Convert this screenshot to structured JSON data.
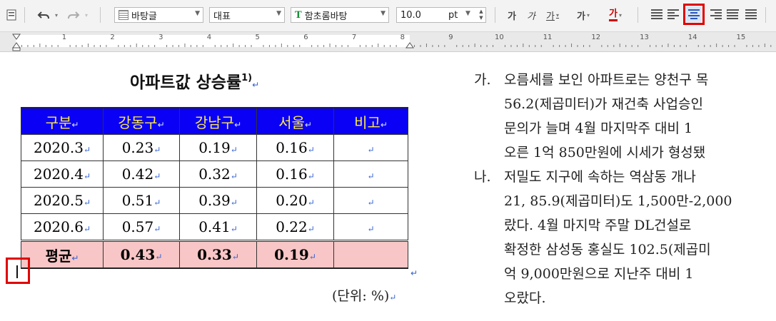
{
  "toolbar": {
    "style_value": "바탕글",
    "lang_value": "대표",
    "font_icon": "T",
    "font_value": "함초롬바탕",
    "size_value": "10.0",
    "size_unit": "pt",
    "bold_label": "가",
    "italic_label": "가",
    "underline_label": "가",
    "strike_label": "가",
    "color_label": "가",
    "highlighted_button": "align-center-button",
    "highlight_color": "#e00000"
  },
  "ruler": {
    "numbers": [
      "1",
      "2",
      "3",
      "4",
      "5",
      "6",
      "7",
      "8",
      "9",
      "10",
      "11",
      "12",
      "13",
      "14",
      "15"
    ]
  },
  "document": {
    "title": "아파트값  상승률",
    "title_sup": "1)",
    "return_mark": "↵",
    "table": {
      "headers": [
        "구분",
        "강동구",
        "강남구",
        "서울",
        "비고"
      ],
      "rows": [
        [
          "2020.3",
          "0.23",
          "0.19",
          "0.16",
          ""
        ],
        [
          "2020.4",
          "0.42",
          "0.32",
          "0.16",
          ""
        ],
        [
          "2020.5",
          "0.51",
          "0.39",
          "0.20",
          ""
        ],
        [
          "2020.6",
          "0.57",
          "0.41",
          "0.22",
          ""
        ]
      ],
      "average": [
        "평균",
        "0.43",
        "0.33",
        "0.19",
        ""
      ],
      "header_bg": "#0a00f5",
      "header_fg": "#ffe94a",
      "average_bg": "#f8c6c6"
    },
    "unit_label": "(단위: %)",
    "paragraphs": [
      {
        "marker": "가.",
        "lines": [
          "오름세를 보인 아파트로는 양천구 목",
          "56.2(제곱미터)가  재건축  사업승인",
          "문의가 늘며 4월 마지막주 대비 1",
          "오른 1억 850만원에 시세가 형성됐"
        ]
      },
      {
        "marker": "나.",
        "lines": [
          "저밀도 지구에 속하는 역삼동 개나",
          "21, 85.9(제곱미터)도 1,500만-2,000",
          "랐다. 4월 마지막 주말 DL건설로",
          "확정한 삼성동 홍실도 102.5(제곱미",
          "억 9,000만원으로 지난주 대비 1",
          "오랐다."
        ]
      }
    ]
  }
}
